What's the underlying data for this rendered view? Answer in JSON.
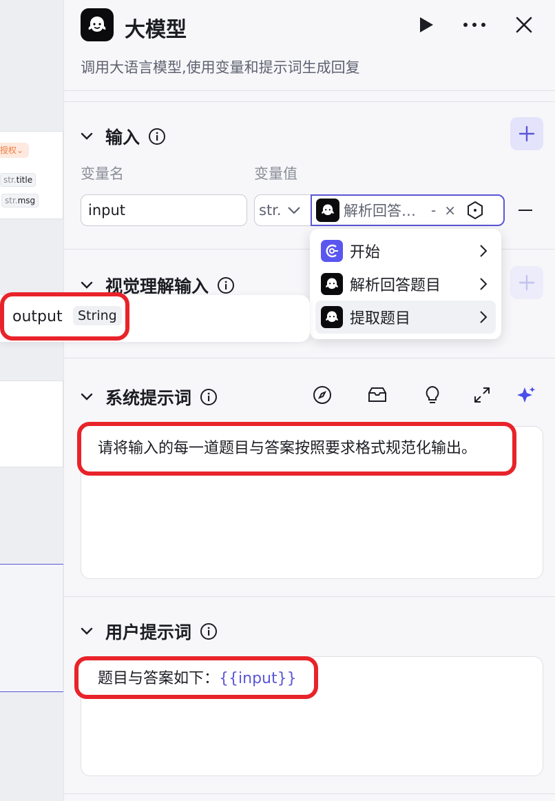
{
  "canvas": {
    "auth_tag": "授权",
    "pills": [
      {
        "type": "str.",
        "name": "title"
      },
      {
        "type": "str.",
        "name": "msg"
      }
    ]
  },
  "header": {
    "title": "大模型",
    "description": "调用大语言模型,使用变量和提示词生成回复",
    "icons": [
      "run-icon",
      "more-icon",
      "close-icon"
    ]
  },
  "input_section": {
    "title": "输入",
    "col_name_label": "变量名",
    "col_value_label": "变量值",
    "row": {
      "name": "input",
      "type": "str.",
      "ref_label": "解析回答…",
      "ref_dash": "-",
      "ref_clear": "×"
    }
  },
  "dropdown": {
    "items": [
      {
        "label": "开始",
        "icon": "start-node-icon"
      },
      {
        "label": "解析回答题目",
        "icon": "llm-node-icon"
      },
      {
        "label": "提取题目",
        "icon": "llm-node-icon",
        "active": true
      }
    ]
  },
  "vision_section": {
    "title": "视觉理解输入"
  },
  "popover": {
    "name": "output",
    "type": "String"
  },
  "system_prompt": {
    "title": "系统提示词",
    "text": "请将输入的每一道题目与答案按照要求格式规范化输出。",
    "tools": [
      "compass-icon",
      "library-icon",
      "bulb-icon",
      "expand-icon",
      "sparkle-icon"
    ]
  },
  "user_prompt": {
    "title": "用户提示词",
    "text_prefix": "题目与答案如下：",
    "text_var": "{{input}}"
  },
  "colors": {
    "accent": "#5a56d6",
    "highlight_red": "#e8232a",
    "add_btn_bg": "#e3e3fb",
    "auth_tag": "#f07d40"
  }
}
